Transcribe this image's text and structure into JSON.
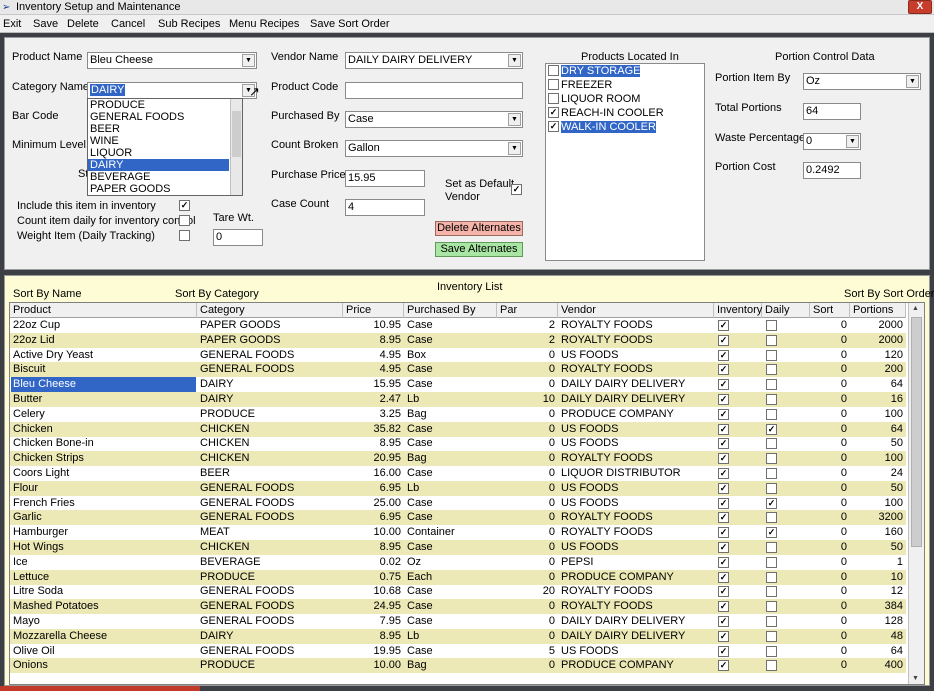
{
  "window": {
    "title": "Inventory Setup and Maintenance",
    "close": "X"
  },
  "menu": [
    "Exit",
    "Save",
    "Delete",
    "Cancel",
    "Sub Recipes",
    "Menu Recipes",
    "Save Sort Order"
  ],
  "product": {
    "name_label": "Product Name",
    "name_value": "Bleu Cheese",
    "category_label": "Category Name",
    "category_value": "DAIRY",
    "barcode_label": "Bar Code",
    "min_label": "Minimum Level",
    "st_partial": "St"
  },
  "category_options": [
    "PRODUCE",
    "GENERAL FOODS",
    "BEER",
    "WINE",
    "LIQUOR",
    "DAIRY",
    "BEVERAGE",
    "PAPER GOODS"
  ],
  "options": {
    "include_label": "Include this item in inventory",
    "count_daily_label": "Count item daily for inventory control",
    "weight_label": "Weight Item (Daily Tracking)",
    "tare_label": "Tare Wt.",
    "tare_value": "0"
  },
  "vendor": {
    "vendor_label": "Vendor Name",
    "vendor_value": "DAILY DAIRY DELIVERY",
    "code_label": "Product Code",
    "code_value": "",
    "purchased_label": "Purchased By",
    "purchased_value": "Case",
    "count_label": "Count Broken",
    "count_value": "Gallon",
    "price_label": "Purchase Price",
    "price_value": "15.95",
    "case_label": "Case Count",
    "case_value": "4",
    "default_label_1": "Set as Default",
    "default_label_2": "Vendor"
  },
  "buttons": {
    "delete_alt": "Delete Alternates",
    "save_alt": "Save Alternates"
  },
  "locations": {
    "title": "Products Located In",
    "items": [
      {
        "label": "DRY STORAGE",
        "checked": false,
        "hl": true
      },
      {
        "label": "FREEZER",
        "checked": false,
        "hl": false
      },
      {
        "label": "LIQUOR ROOM",
        "checked": false,
        "hl": false
      },
      {
        "label": "REACH-IN COOLER",
        "checked": true,
        "hl": false
      },
      {
        "label": "WALK-IN COOLER",
        "checked": true,
        "hl": true
      }
    ]
  },
  "portion": {
    "title": "Portion Control Data",
    "item_by_label": "Portion Item By",
    "item_by_value": "Oz",
    "total_label": "Total Portions",
    "total_value": "64",
    "waste_label": "Waste Percentage",
    "waste_value": "0",
    "cost_label": "Portion Cost",
    "cost_value": "0.2492"
  },
  "inventory": {
    "title": "Inventory List",
    "sort_name": "Sort By Name",
    "sort_category": "Sort By Category",
    "sort_order": "Sort By Sort Order",
    "columns": [
      "Product",
      "Category",
      "Price",
      "Purchased By",
      "Par",
      "Vendor",
      "Inventory",
      "Daily",
      "Sort",
      "Portions"
    ],
    "rows": [
      [
        "22oz Cup",
        "PAPER GOODS",
        "10.95",
        "Case",
        "2",
        "ROYALTY FOODS",
        true,
        false,
        "0",
        "2000"
      ],
      [
        "22oz Lid",
        "PAPER GOODS",
        "8.95",
        "Case",
        "2",
        "ROYALTY FOODS",
        true,
        false,
        "0",
        "2000"
      ],
      [
        "Active Dry Yeast",
        "GENERAL FOODS",
        "4.95",
        "Box",
        "0",
        "US FOODS",
        true,
        false,
        "0",
        "120"
      ],
      [
        "Biscuit",
        "GENERAL FOODS",
        "4.95",
        "Case",
        "0",
        "ROYALTY FOODS",
        true,
        false,
        "0",
        "200"
      ],
      [
        "Bleu Cheese",
        "DAIRY",
        "15.95",
        "Case",
        "0",
        "DAILY DAIRY DELIVERY",
        true,
        false,
        "0",
        "64"
      ],
      [
        "Butter",
        "DAIRY",
        "2.47",
        "Lb",
        "10",
        "DAILY DAIRY DELIVERY",
        true,
        false,
        "0",
        "16"
      ],
      [
        "Celery",
        "PRODUCE",
        "3.25",
        "Bag",
        "0",
        "PRODUCE COMPANY",
        true,
        false,
        "0",
        "100"
      ],
      [
        "Chicken",
        "CHICKEN",
        "35.82",
        "Case",
        "0",
        "US FOODS",
        true,
        true,
        "0",
        "64"
      ],
      [
        "Chicken Bone-in",
        "CHICKEN",
        "8.95",
        "Case",
        "0",
        "US FOODS",
        true,
        false,
        "0",
        "50"
      ],
      [
        "Chicken Strips",
        "CHICKEN",
        "20.95",
        "Bag",
        "0",
        "ROYALTY FOODS",
        true,
        false,
        "0",
        "100"
      ],
      [
        "Coors Light",
        "BEER",
        "16.00",
        "Case",
        "0",
        "LIQUOR DISTRIBUTOR",
        true,
        false,
        "0",
        "24"
      ],
      [
        "Flour",
        "GENERAL FOODS",
        "6.95",
        "Lb",
        "0",
        "US FOODS",
        true,
        false,
        "0",
        "50"
      ],
      [
        "French Fries",
        "GENERAL FOODS",
        "25.00",
        "Case",
        "0",
        "US FOODS",
        true,
        true,
        "0",
        "100"
      ],
      [
        "Garlic",
        "GENERAL FOODS",
        "6.95",
        "Case",
        "0",
        "ROYALTY FOODS",
        true,
        false,
        "0",
        "3200"
      ],
      [
        "Hamburger",
        "MEAT",
        "10.00",
        "Container",
        "0",
        "ROYALTY FOODS",
        true,
        true,
        "0",
        "160"
      ],
      [
        "Hot Wings",
        "CHICKEN",
        "8.95",
        "Case",
        "0",
        "US FOODS",
        true,
        false,
        "0",
        "50"
      ],
      [
        "Ice",
        "BEVERAGE",
        "0.02",
        "Oz",
        "0",
        "PEPSI",
        true,
        false,
        "0",
        "1"
      ],
      [
        "Lettuce",
        "PRODUCE",
        "0.75",
        "Each",
        "0",
        "PRODUCE COMPANY",
        true,
        false,
        "0",
        "10"
      ],
      [
        "Litre Soda",
        "GENERAL FOODS",
        "10.68",
        "Case",
        "20",
        "ROYALTY FOODS",
        true,
        false,
        "0",
        "12"
      ],
      [
        "Mashed Potatoes",
        "GENERAL FOODS",
        "24.95",
        "Case",
        "0",
        "ROYALTY FOODS",
        true,
        false,
        "0",
        "384"
      ],
      [
        "Mayo",
        "GENERAL FOODS",
        "7.95",
        "Case",
        "0",
        "DAILY DAIRY DELIVERY",
        true,
        false,
        "0",
        "128"
      ],
      [
        "Mozzarella Cheese",
        "DAIRY",
        "8.95",
        "Lb",
        "0",
        "DAILY DAIRY DELIVERY",
        true,
        false,
        "0",
        "48"
      ],
      [
        "Olive Oil",
        "GENERAL FOODS",
        "19.95",
        "Case",
        "5",
        "US FOODS",
        true,
        false,
        "0",
        "64"
      ],
      [
        "Onions",
        "PRODUCE",
        "10.00",
        "Bag",
        "0",
        "PRODUCE COMPANY",
        true,
        false,
        "0",
        "400"
      ]
    ]
  }
}
